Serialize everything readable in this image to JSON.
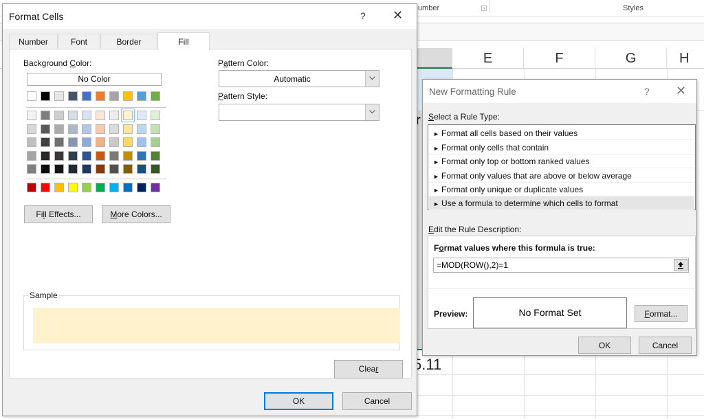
{
  "excel": {
    "ribbon_groups": [
      "Number",
      "Styles"
    ],
    "column_headers": [
      "E",
      "F",
      "G",
      "H"
    ],
    "visible_cell_value": "5.11"
  },
  "format_cells": {
    "title": "Format Cells",
    "help_glyph": "?",
    "close_glyph": "✕",
    "tabs": [
      {
        "label": "Number",
        "active": false
      },
      {
        "label": "Font",
        "active": false
      },
      {
        "label": "Border",
        "active": false
      },
      {
        "label": "Fill",
        "active": true
      }
    ],
    "background_color_label_pre": "Background ",
    "background_color_label_key": "C",
    "background_color_label_post": "olor:",
    "no_color_label": "No Color",
    "theme_top_row": [
      "#ffffff",
      "#000000",
      "#e7e6e6",
      "#44546a",
      "#4472c4",
      "#ed7d31",
      "#a5a5a5",
      "#ffc000",
      "#5b9bd5",
      "#70ad47"
    ],
    "theme_shades": [
      [
        "#f2f2f2",
        "#7f7f7f",
        "#d0cece",
        "#d6dce4",
        "#d9e2f3",
        "#fbe5d5",
        "#ededed",
        "#fff2cc",
        "#deebf6",
        "#e2efd9"
      ],
      [
        "#d8d8d8",
        "#595959",
        "#aeabab",
        "#adb9ca",
        "#b4c6e7",
        "#f7cbac",
        "#dbdbdb",
        "#fee599",
        "#bdd7ee",
        "#c5e0b3"
      ],
      [
        "#bfbfbf",
        "#3f3f3f",
        "#757070",
        "#8496b0",
        "#8eaadb",
        "#f4b183",
        "#c9c9c9",
        "#ffd965",
        "#9dc3e6",
        "#a8d08d"
      ],
      [
        "#a5a5a5",
        "#262626",
        "#3a3838",
        "#323f4f",
        "#2f5496",
        "#c55a11",
        "#7b7b7b",
        "#bf8f00",
        "#2e75b5",
        "#538135"
      ],
      [
        "#7f7f7f",
        "#0c0c0c",
        "#171616",
        "#222a35",
        "#1f3864",
        "#833c0b",
        "#525252",
        "#7f6000",
        "#1e4e79",
        "#375623"
      ]
    ],
    "selected_swatch": {
      "row": 0,
      "col": 7
    },
    "standard_colors": [
      "#c00000",
      "#ff0000",
      "#ffc000",
      "#ffff00",
      "#92d050",
      "#00b050",
      "#00b0f0",
      "#0070c0",
      "#002060",
      "#7030a0"
    ],
    "fill_effects_pre": "Fi",
    "fill_effects_key": "l",
    "fill_effects_post": "l Effects...",
    "more_colors_key": "M",
    "more_colors_post": "ore Colors...",
    "pattern_color_pre": "P",
    "pattern_color_key": "a",
    "pattern_color_post": "ttern Color:",
    "pattern_color_value": "Automatic",
    "pattern_style_key": "P",
    "pattern_style_post": "attern Style:",
    "pattern_style_value": "",
    "sample_label": "Sample",
    "sample_color": "#fff2cc",
    "clear_pre": "Clea",
    "clear_key": "r",
    "ok_label": "OK",
    "cancel_label": "Cancel"
  },
  "new_formatting_rule": {
    "title": "New Formatting Rule",
    "help_glyph": "?",
    "close_glyph": "✕",
    "select_rule_type_key": "S",
    "select_rule_type_post": "elect a Rule Type:",
    "rule_types": [
      {
        "label": "Format all cells based on their values",
        "selected": false
      },
      {
        "label": "Format only cells that contain",
        "selected": false
      },
      {
        "label": "Format only top or bottom ranked values",
        "selected": false
      },
      {
        "label": "Format only values that are above or below average",
        "selected": false
      },
      {
        "label": "Format only unique or duplicate values",
        "selected": false
      },
      {
        "label": "Use a formula to determine which cells to format",
        "selected": true
      }
    ],
    "edit_desc_key": "E",
    "edit_desc_post": "dit the Rule Description:",
    "formula_label_pre": "F",
    "formula_label_key": "o",
    "formula_label_post": "rmat values where this formula is true:",
    "formula_value": "=MOD(ROW(),2)=1",
    "preview_label": "Preview:",
    "preview_text": "No Format Set",
    "format_button_key": "F",
    "format_button_post": "ormat...",
    "ok_label": "OK",
    "cancel_label": "Cancel"
  }
}
